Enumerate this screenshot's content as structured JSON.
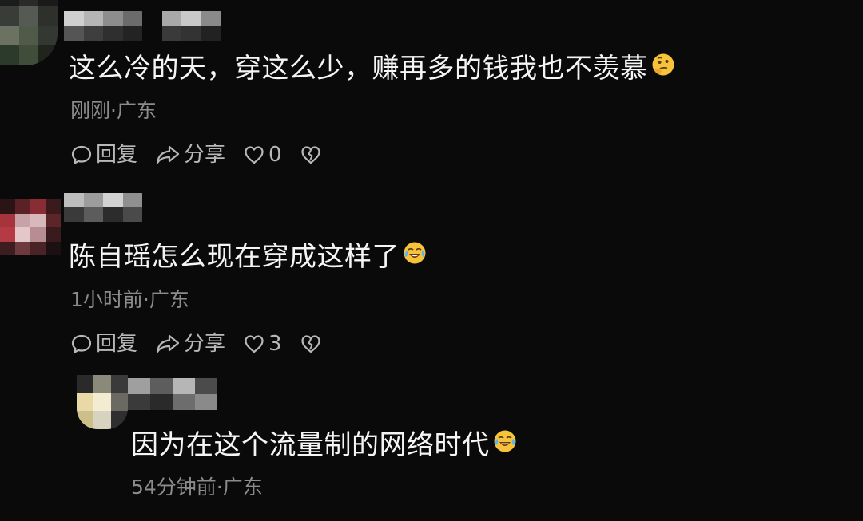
{
  "comments": [
    {
      "text": "这么冷的天，穿这么少，赚再多的钱我也不羡慕",
      "emoji": "thinking-face-emoji",
      "meta": "刚刚·广东",
      "reply_label": "回复",
      "share_label": "分享",
      "likes": "0"
    },
    {
      "text": "陈自瑶怎么现在穿成这样了",
      "emoji": "crying-laughing-emoji",
      "meta": "1小时前·广东",
      "reply_label": "回复",
      "share_label": "分享",
      "likes": "3"
    },
    {
      "text": "因为在这个流量制的网络时代",
      "emoji": "crying-laughing-emoji",
      "meta": "54分钟前·广东"
    }
  ],
  "colors": {
    "background": "#0a0a0a",
    "text": "#f5f5f5",
    "meta": "#8c8c8c",
    "action": "#b8b8b8"
  },
  "icons": {
    "reply": "speech-bubble-icon",
    "share": "share-arrow-icon",
    "like": "heart-icon",
    "dislike": "broken-heart-icon"
  }
}
